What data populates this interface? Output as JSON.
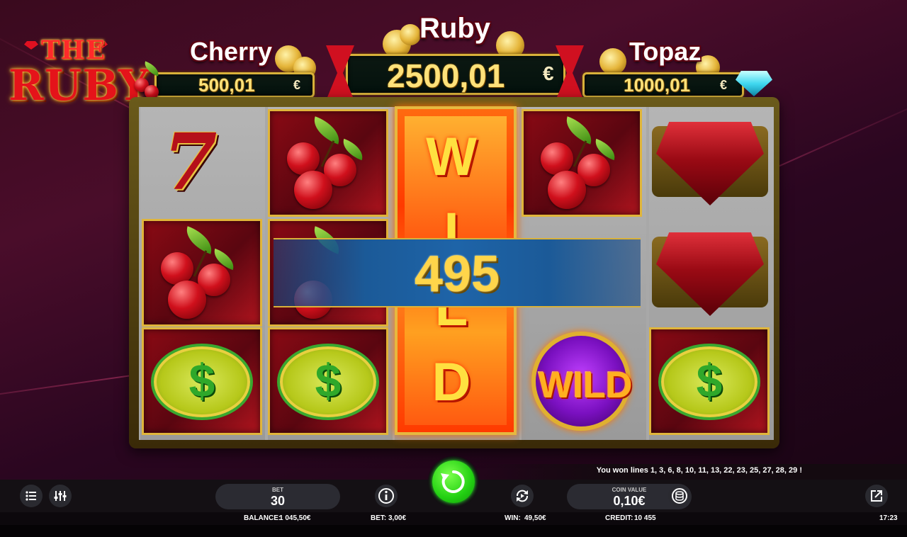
{
  "logo": {
    "line1": "THE",
    "line2": "RUBY"
  },
  "jackpots": {
    "cherry": {
      "name": "Cherry",
      "value": "500,01",
      "currency": "€"
    },
    "ruby": {
      "name": "Ruby",
      "value": "2500,01",
      "currency": "€"
    },
    "topaz": {
      "name": "Topaz",
      "value": "1000,01",
      "currency": "€"
    }
  },
  "reels": {
    "columns": [
      [
        "seven",
        "cherry",
        "dollar"
      ],
      [
        "cherry",
        "cherry",
        "dollar"
      ],
      [
        "wild-expanded"
      ],
      [
        "cherry",
        "blank",
        "wild"
      ],
      [
        "ruby-gem",
        "ruby-gem",
        "dollar"
      ]
    ],
    "wild_letters": [
      "W",
      "I",
      "L",
      "D"
    ],
    "wild_symbol_text": "WILD",
    "seven_text": "7",
    "dollar_text": "$"
  },
  "win": {
    "amount": "495"
  },
  "status_message": "You won lines 1, 3, 6, 8, 10, 11, 13, 22, 23, 25, 27, 28, 29 !",
  "controls": {
    "bet_label": "BET",
    "bet_value": "30",
    "coin_value_label": "COIN VALUE",
    "coin_value": "0,10€",
    "icons": [
      "menu-icon",
      "settings-icon",
      "info-icon",
      "spin-icon",
      "autoplay-icon",
      "coins-icon",
      "external-link-icon"
    ]
  },
  "info_bar": {
    "balance_label": "BALANCE:",
    "balance_value": "1 045,50€",
    "bet_label": "BET:",
    "bet_value": "3,00€",
    "win_label": "WIN:",
    "win_value": "49,50€",
    "credit_label": "CREDIT:",
    "credit_value": "10 455",
    "time": "17:23"
  },
  "colors": {
    "accent_gold": "#e0b53a",
    "spin_green": "#22d012",
    "ruby_red": "#d0101c",
    "banner_blue": "#1e64a8"
  }
}
